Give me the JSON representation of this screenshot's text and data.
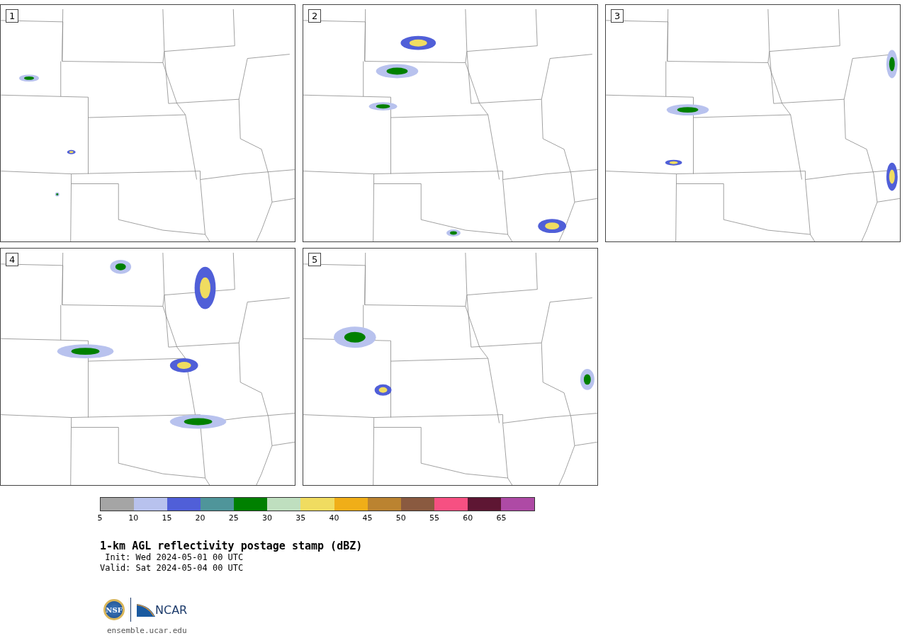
{
  "panels": [
    {
      "label": "1"
    },
    {
      "label": "2"
    },
    {
      "label": "3"
    },
    {
      "label": "4"
    },
    {
      "label": "5"
    }
  ],
  "colorbar": {
    "segments": [
      {
        "color": "#a5a5a5"
      },
      {
        "color": "#b8c2ee"
      },
      {
        "color": "#505fd8"
      },
      {
        "color": "#4f959a"
      },
      {
        "color": "#008000"
      },
      {
        "color": "#bfdfbf"
      },
      {
        "color": "#f0dc60"
      },
      {
        "color": "#f0ae18"
      },
      {
        "color": "#bb8330"
      },
      {
        "color": "#8a5a40"
      },
      {
        "color": "#f65082"
      },
      {
        "color": "#5e1633"
      },
      {
        "color": "#ae4aa5"
      }
    ],
    "ticks": [
      "5",
      "10",
      "15",
      "20",
      "25",
      "30",
      "35",
      "40",
      "45",
      "50",
      "55",
      "60",
      "65"
    ]
  },
  "title": "1-km AGL reflectivity postage stamp (dBZ)",
  "init": " Init: Wed 2024-05-01 00 UTC",
  "valid": "Valid: Sat 2024-05-04 00 UTC",
  "logos": {
    "nsf": "NSF",
    "ncar": "NCAR"
  },
  "url": "ensemble.ucar.edu"
}
